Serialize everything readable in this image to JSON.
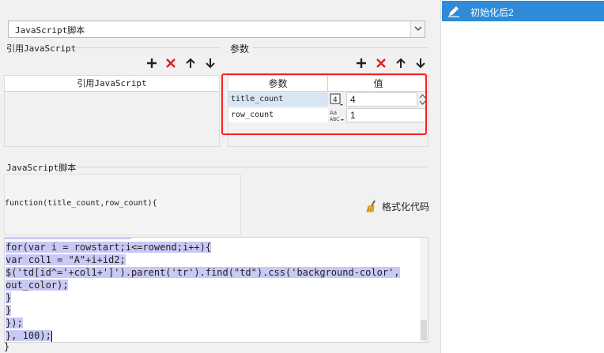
{
  "script_select": {
    "value": "JavaScript脚本"
  },
  "ref_js": {
    "section_title": "引用JavaScript",
    "column_header": "引用JavaScript"
  },
  "params": {
    "section_title": "参数",
    "headers": [
      "参数",
      "值"
    ],
    "rows": [
      {
        "name": "title_count",
        "type_icon": "number-type-icon",
        "value": "4"
      },
      {
        "name": "row_count",
        "type_icon": "text-type-icon",
        "value": "1"
      }
    ]
  },
  "script": {
    "section_title": "JavaScript脚本",
    "function_signature": "function(title_count,row_count){",
    "format_button_label": "格式化代码",
    "code_lines": [
      "for(var i = rowstart;i<=rowend;i++){",
      "var col1 = \"A\"+i+id2;",
      "$('td[id^='+col1+']').parent('tr').find(\"td\").css('background-color',",
      "out_color);",
      "}",
      "}",
      "});",
      "}, 100);"
    ],
    "last_line": "}"
  },
  "tree": {
    "item_label": "初始化后2",
    "item_icon": "pencil-icon"
  },
  "colors": {
    "highlight_border": "#ff1e1e",
    "tree_selected": "#2f8ad8",
    "selection": "#c9c9f5",
    "delete_red": "#e02020"
  }
}
